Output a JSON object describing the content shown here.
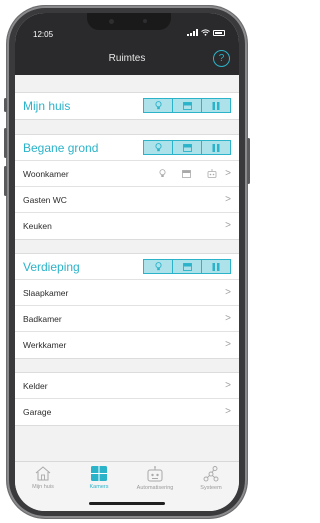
{
  "status": {
    "time": "12:05"
  },
  "nav": {
    "title": "Ruimtes",
    "help": "?"
  },
  "sections": [
    {
      "title": "Mijn huis",
      "rooms": []
    },
    {
      "title": "Begane grond",
      "rooms": [
        {
          "name": "Woonkamer",
          "has_icons": true
        },
        {
          "name": "Gasten WC"
        },
        {
          "name": "Keuken"
        }
      ]
    },
    {
      "title": "Verdieping",
      "rooms": [
        {
          "name": "Slaapkamer"
        },
        {
          "name": "Badkamer"
        },
        {
          "name": "Werkkamer"
        }
      ]
    }
  ],
  "other_rooms": [
    {
      "name": "Kelder"
    },
    {
      "name": "Garage"
    }
  ],
  "tabs": [
    {
      "label": "Mijn huis",
      "icon": "home-icon",
      "active": false
    },
    {
      "label": "Kamers",
      "icon": "rooms-grid-icon",
      "active": true
    },
    {
      "label": "Automatisering",
      "icon": "robot-icon",
      "active": false
    },
    {
      "label": "Systeem",
      "icon": "network-icon",
      "active": false
    }
  ],
  "colors": {
    "accent": "#2bb3c9",
    "header": "#2a2a2c",
    "toggle_fill": "#aee2ea"
  }
}
